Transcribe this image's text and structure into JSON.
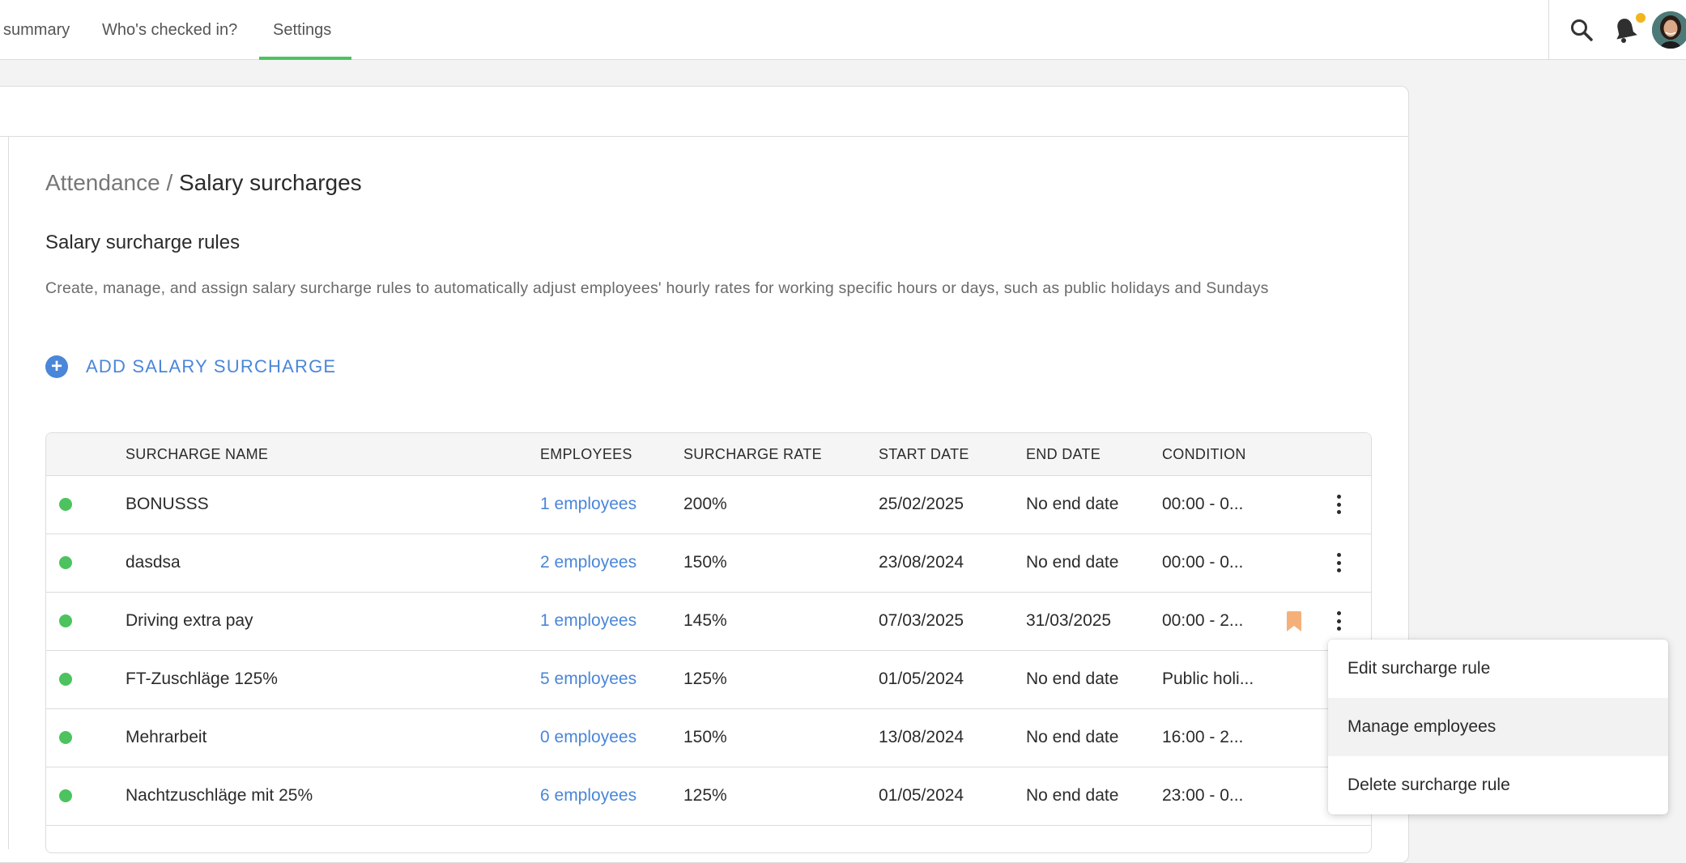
{
  "topnav": {
    "tabs": [
      {
        "label": "summary"
      },
      {
        "label": "Who's checked in?"
      },
      {
        "label": "Settings",
        "active": true
      }
    ],
    "icons": [
      "search-icon",
      "bell-icon",
      "avatar"
    ],
    "notification_dot_color": "#f2b51d"
  },
  "breadcrumb": {
    "parent": "Attendance /",
    "current": "Salary surcharges"
  },
  "section": {
    "title": "Salary surcharge rules",
    "description": "Create, manage, and assign salary surcharge rules to automatically adjust employees' hourly rates for working specific hours or days, such as public holidays and Sundays"
  },
  "add_button": {
    "icon": "plus-circle-icon",
    "label": "ADD SALARY SURCHARGE"
  },
  "table": {
    "columns": [
      "SURCHARGE NAME",
      "EMPLOYEES",
      "SURCHARGE RATE",
      "START DATE",
      "END DATE",
      "CONDITION"
    ],
    "rows": [
      {
        "name": "BONUSSS",
        "employees": "1 employees",
        "rate": "200%",
        "start": "25/02/2025",
        "end": "No end date",
        "condition": "00:00 - 0...",
        "bookmark": false
      },
      {
        "name": "dasdsa",
        "employees": "2 employees",
        "rate": "150%",
        "start": "23/08/2024",
        "end": "No end date",
        "condition": "00:00 - 0...",
        "bookmark": false
      },
      {
        "name": "Driving extra pay",
        "employees": "1 employees",
        "rate": "145%",
        "start": "07/03/2025",
        "end": "31/03/2025",
        "condition": "00:00 - 2...",
        "bookmark": true
      },
      {
        "name": "FT-Zuschläge 125%",
        "employees": "5 employees",
        "rate": "125%",
        "start": "01/05/2024",
        "end": "No end date",
        "condition": "Public holi...",
        "bookmark": false
      },
      {
        "name": "Mehrarbeit",
        "employees": "0 employees",
        "rate": "150%",
        "start": "13/08/2024",
        "end": "No end date",
        "condition": "16:00 - 2...",
        "bookmark": false
      },
      {
        "name": "Nachtzuschläge mit 25%",
        "employees": "6 employees",
        "rate": "125%",
        "start": "01/05/2024",
        "end": "No end date",
        "condition": "23:00 - 0...",
        "bookmark": false
      }
    ],
    "status_color": "#4cc35e",
    "link_color": "#4a86d9",
    "bookmark_color": "#f5b07a"
  },
  "context_menu": {
    "items": [
      {
        "label": "Edit surcharge rule"
      },
      {
        "label": "Manage employees",
        "hovered": true
      },
      {
        "label": "Delete surcharge rule"
      }
    ]
  }
}
